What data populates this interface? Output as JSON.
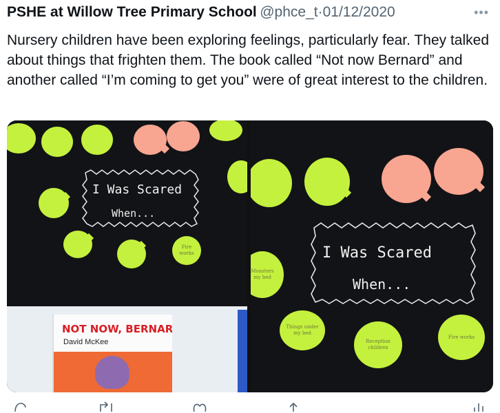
{
  "tweet": {
    "author_name": "PSHE at Willow Tree Primary School",
    "handle": "@phce_t",
    "separator": "·",
    "date": "01/12/2020",
    "text": "Nursery children have been exploring feelings, particularly fear.  They talked about things that frighten them.  The book called “Not now Bernard” and another called “I’m coming to get you” were of great interest to the children."
  },
  "media": {
    "left_photo": {
      "board_heading_line1": "I Was Scared",
      "board_heading_line2": "When...",
      "book_title": "NOT NOW, BERNARD",
      "book_author": "David McKee",
      "notes": [
        {
          "text": "",
          "color": "green"
        },
        {
          "text": "",
          "color": "green"
        },
        {
          "text": "",
          "color": "green"
        },
        {
          "text": "",
          "color": "pink"
        },
        {
          "text": "",
          "color": "pink"
        },
        {
          "text": "",
          "color": "green"
        },
        {
          "text": "",
          "color": "green"
        },
        {
          "text": "",
          "color": "green"
        },
        {
          "text": "",
          "color": "green"
        },
        {
          "text": "",
          "color": "green"
        },
        {
          "text": "Fire works",
          "color": "green"
        }
      ]
    },
    "right_photo": {
      "board_heading_line1": "I  Was  Scared",
      "board_heading_line2": "When...",
      "notes": [
        {
          "text": "",
          "color": "green"
        },
        {
          "text": "",
          "color": "green"
        },
        {
          "text": "",
          "color": "pink"
        },
        {
          "text": "",
          "color": "pink"
        },
        {
          "text": "Monsters my bed",
          "color": "green"
        },
        {
          "text": "Things under my bed",
          "color": "green"
        },
        {
          "text": "Reception children",
          "color": "green"
        },
        {
          "text": "Fire works",
          "color": "green"
        }
      ]
    }
  },
  "actions": [
    {
      "name": "reply-icon"
    },
    {
      "name": "retweet-icon"
    },
    {
      "name": "like-icon"
    },
    {
      "name": "share-icon"
    },
    {
      "name": "analytics-icon"
    }
  ],
  "colors": {
    "text": "#0f1419",
    "muted": "#536471",
    "note_green": "#c4f13e",
    "note_pink": "#f8a591",
    "board_black": "#121317",
    "book_red": "#d81e24",
    "book_orange": "#ef6a34"
  }
}
